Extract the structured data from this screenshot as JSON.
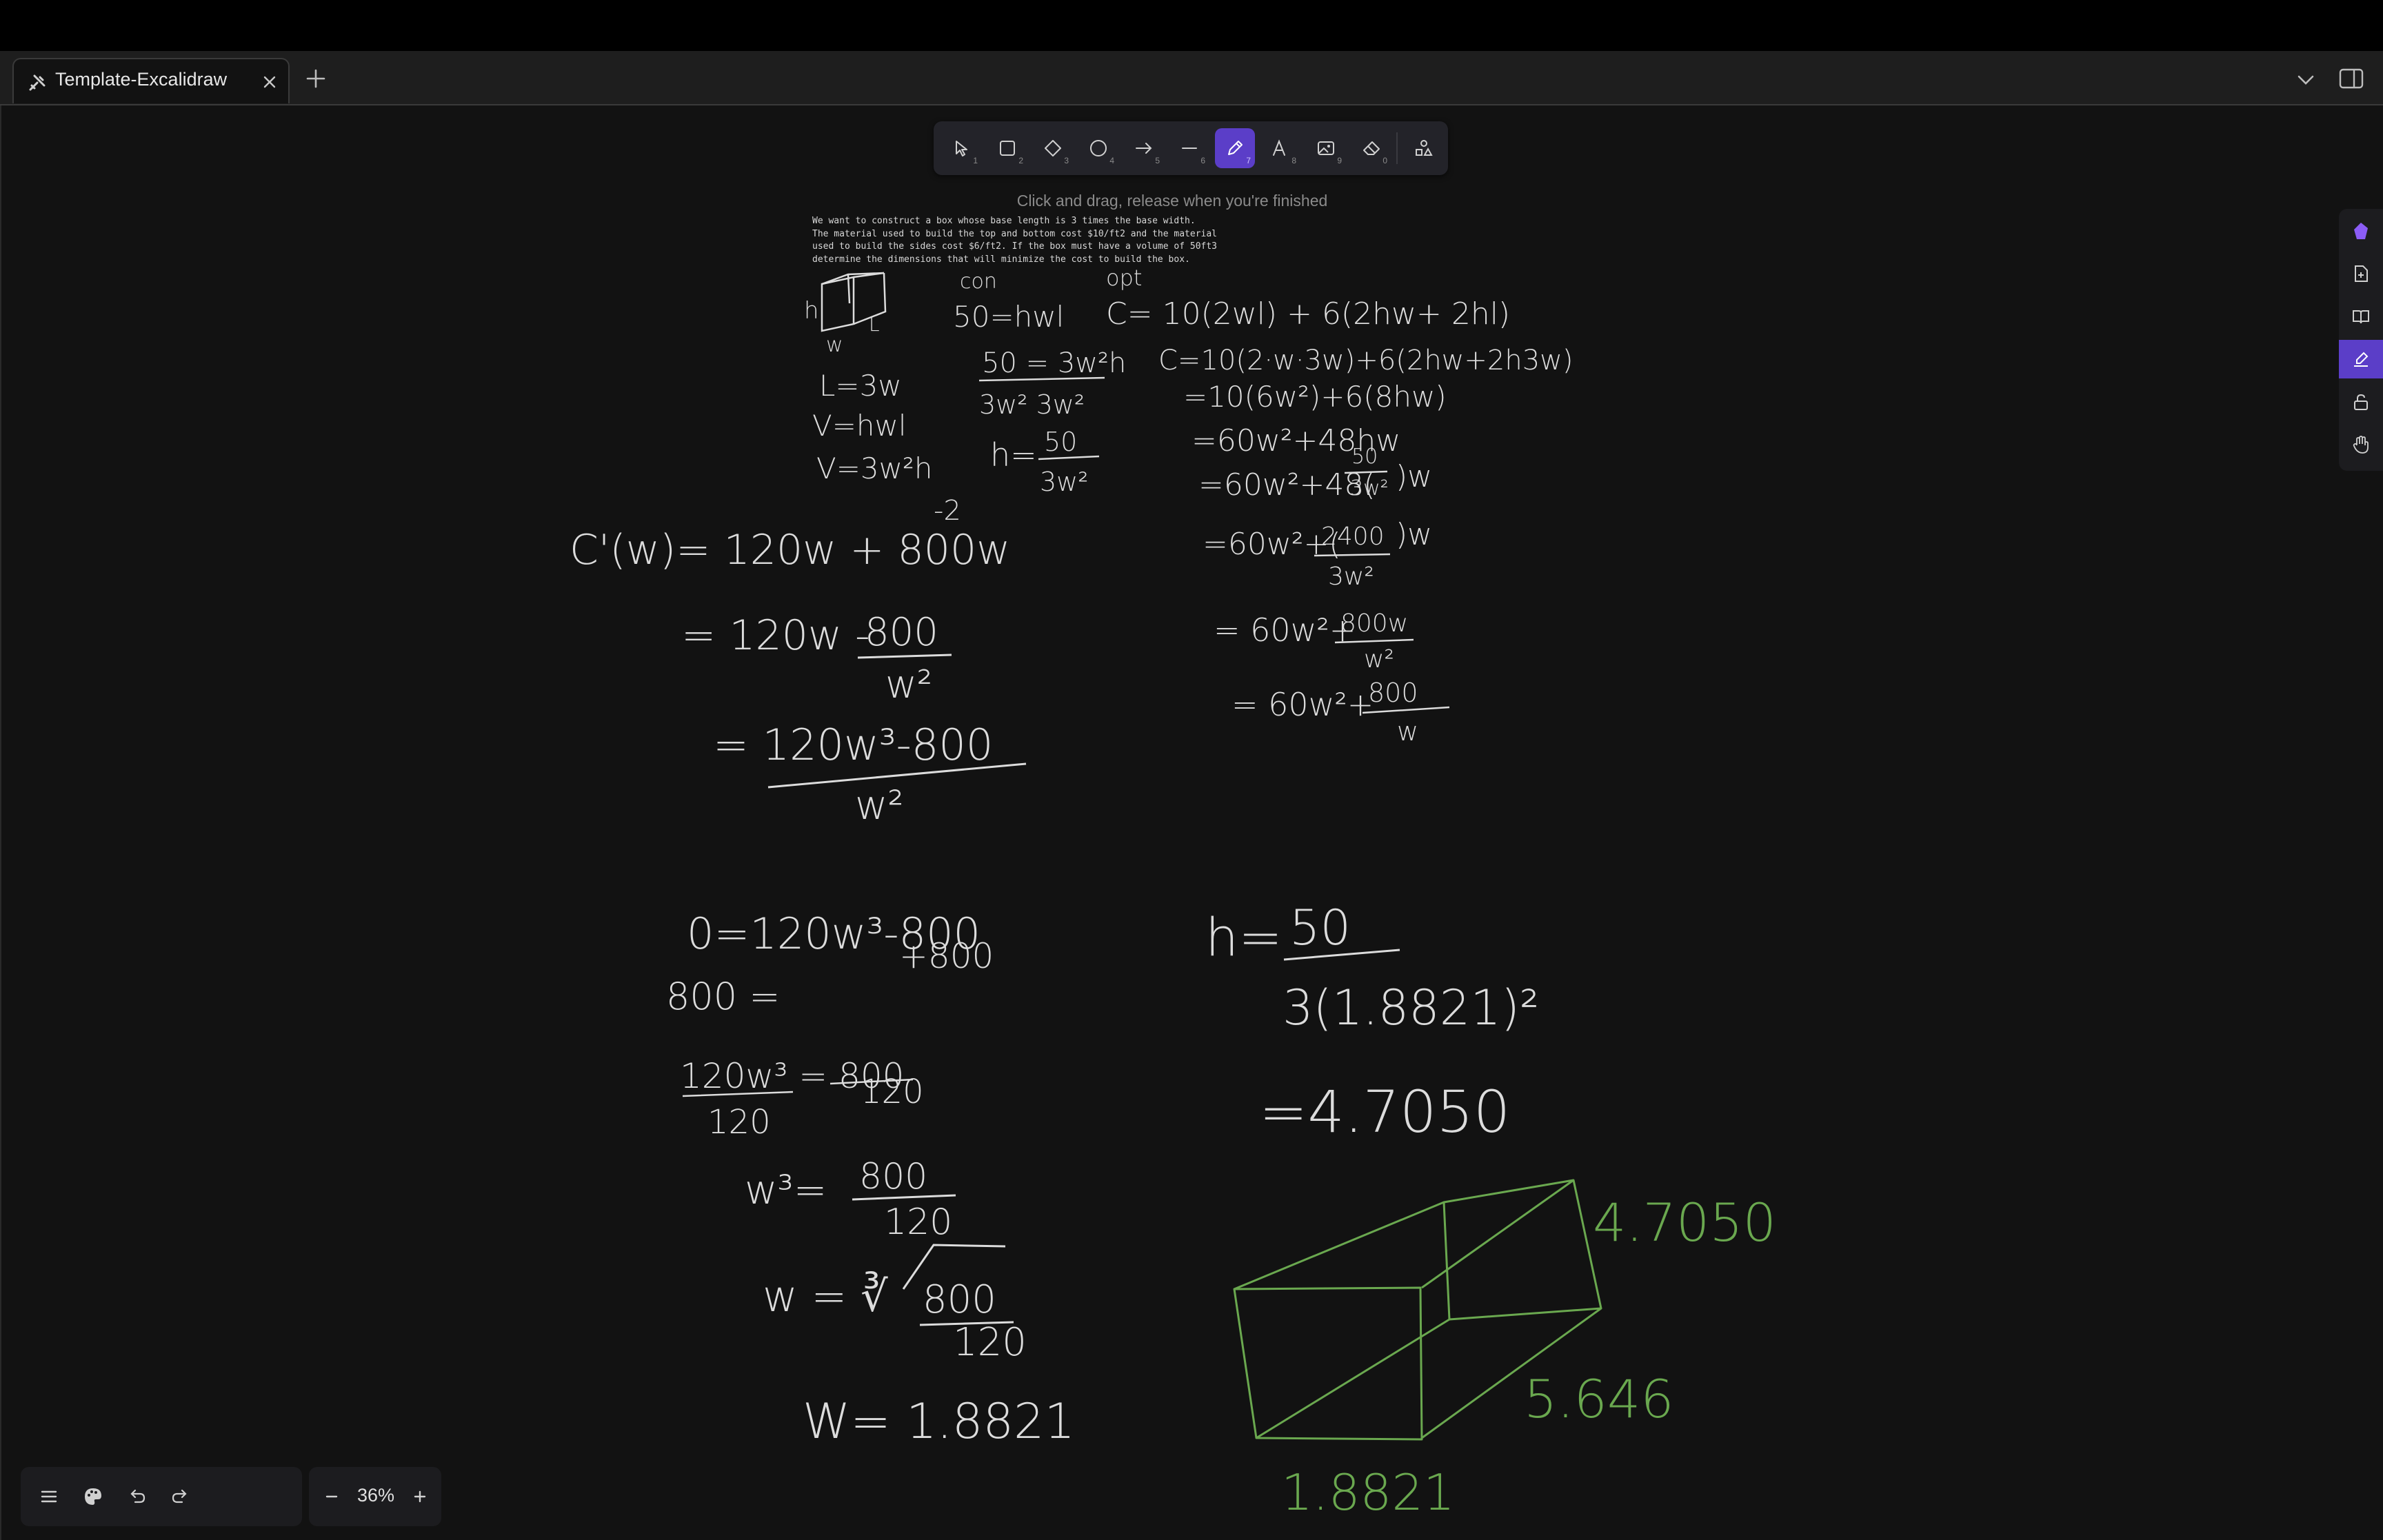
{
  "tab": {
    "title": "Template-Excalidraw",
    "close_icon": "close-icon",
    "app_icon": "excalidraw-icon"
  },
  "toolbar": {
    "tools": [
      {
        "name": "selection",
        "key": "1",
        "icon": "pointer-icon"
      },
      {
        "name": "rectangle",
        "key": "2",
        "icon": "rectangle-icon"
      },
      {
        "name": "diamond",
        "key": "3",
        "icon": "diamond-icon"
      },
      {
        "name": "ellipse",
        "key": "4",
        "icon": "ellipse-icon"
      },
      {
        "name": "arrow",
        "key": "5",
        "icon": "arrow-icon"
      },
      {
        "name": "line",
        "key": "6",
        "icon": "line-icon"
      },
      {
        "name": "draw",
        "key": "7",
        "icon": "pencil-icon",
        "active": true
      },
      {
        "name": "text",
        "key": "8",
        "icon": "text-icon"
      },
      {
        "name": "image",
        "key": "9",
        "icon": "image-icon"
      },
      {
        "name": "eraser",
        "key": "0",
        "icon": "eraser-icon"
      },
      {
        "name": "extra-tools",
        "key": "",
        "icon": "shapes-icon"
      }
    ],
    "active_color": "#5b3ec8"
  },
  "hint": "Click and drag, release when you're finished",
  "problem": {
    "line1": "We want to construct a box whose base length is 3 times the base width.",
    "line2": "The material used to build the top and bottom cost $10/ft2 and the material",
    "line3": "used to build the sides cost $6/ft2. If the box must have a volume of 50ft3",
    "line4": "determine the dimensions that will minimize the cost to build the box."
  },
  "handwriting": {
    "con": "con",
    "opt": "opt",
    "v_eq": "50=hwl",
    "cost": "C= 10(2wl) + 6(2hw+ 2hl)",
    "label_h": "h",
    "label_w": "w",
    "label_l": "L",
    "l3w": "L=3w",
    "vhwl": "V=hwl",
    "v3w2h": "V=3w²h",
    "frac_top": "50 = 3w²h",
    "frac_bot": "3w²    3w²",
    "h_eq": "h=",
    "h_num": "50",
    "h_den": "3w²",
    "c2": "C=10(2·w·3w)+6(2hw+2h3w)",
    "c3": "=10(6w²)+6(8hw)",
    "c4": "=60w²+48hw",
    "c5": "=60w²+48(",
    "c5_num": "50",
    "c5_den": "3w²",
    "c5_tail": ")w",
    "c6": "=60w²+(",
    "c6_num": "2400",
    "c6_den": "3w²",
    "c6_tail": ")w",
    "c7": "= 60w²+",
    "c7_num": "800w",
    "c7_den": "w²",
    "c8": "= 60w²+",
    "c8_num": "800",
    "c8_den": "w",
    "d1": "C'(w)= 120w + 800w",
    "d1_exp": "-2",
    "d2": "= 120w -",
    "d2_num": "800",
    "d2_den": "w²",
    "d3_num": "= 120w³-800",
    "d3_den": "w²",
    "s1": "0=120w³-800",
    "s1b": "+800",
    "s2": "800 =",
    "s3": "120w³ = 800",
    "s3_den_l": "120",
    "s3_den_r": "120",
    "s4": "w³=",
    "s4_num": "800",
    "s4_den": "120",
    "s5": "w = ∛",
    "s5_num": "800",
    "s5_den": "120",
    "s6": "W= 1.8821",
    "r1": "h=",
    "r1_num": "50",
    "r1_den": "3(1.8821)²",
    "r2": "=4.7050",
    "box_h": "4.7050",
    "box_l": "5.646",
    "box_w": "1.8821"
  },
  "colors": {
    "ink": "#dcdcdc",
    "green": "#6aa84f"
  },
  "zoom": {
    "level": "36%"
  }
}
